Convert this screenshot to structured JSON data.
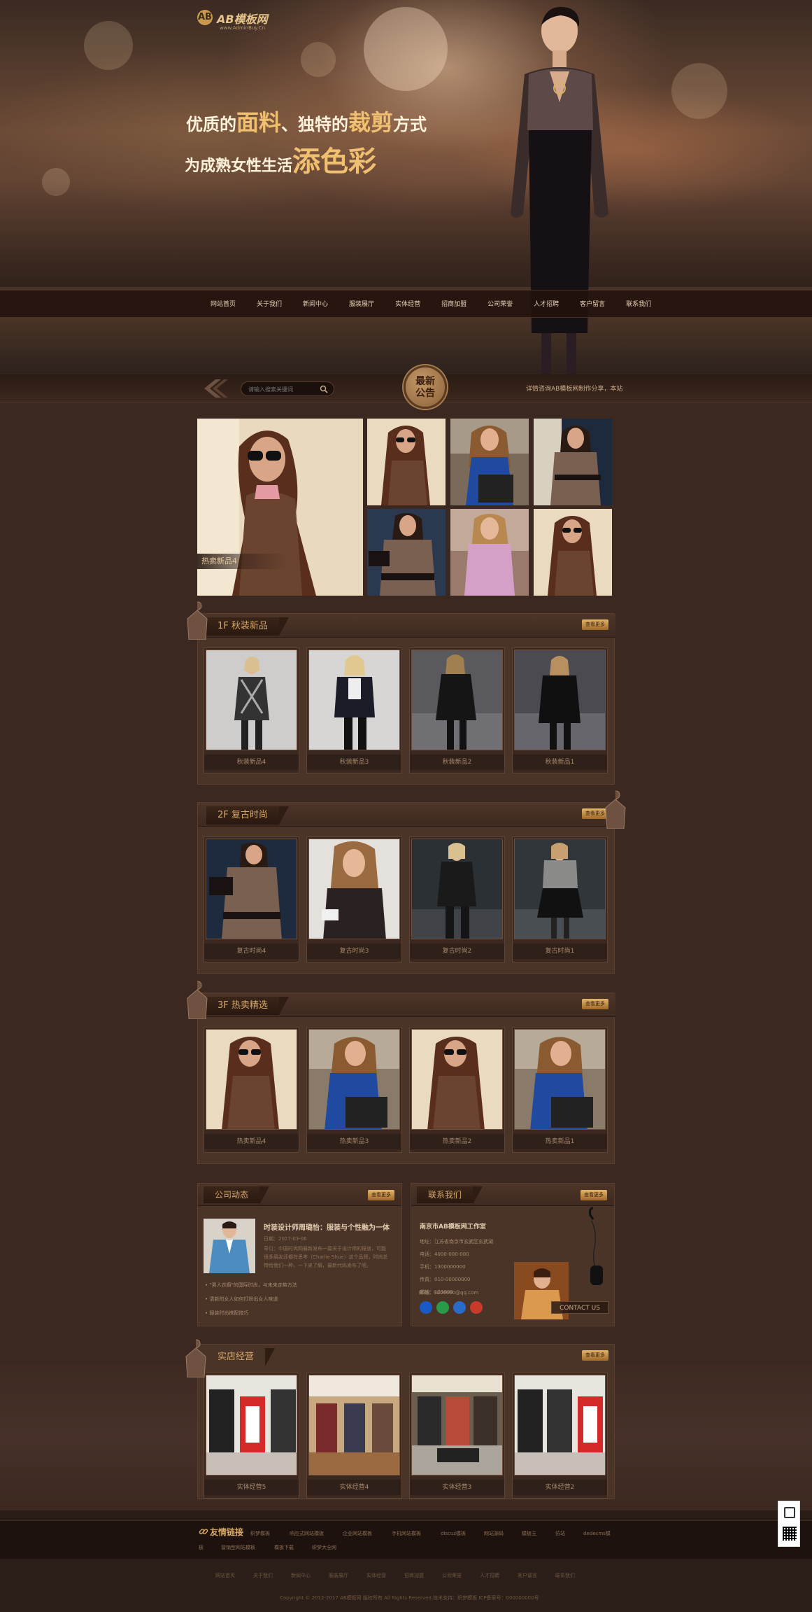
{
  "brand": {
    "logo_mark": "AB",
    "name": "AB模板网",
    "url": "www.AdminBuy.Cn"
  },
  "hero": {
    "slogan1_a": "优质的",
    "slogan1_b": "面料",
    "slogan1_c": "、独特的",
    "slogan1_d": "裁剪",
    "slogan1_e": "方式",
    "slogan2_a": "为成熟女性生活",
    "slogan2_b": "添色彩"
  },
  "nav": {
    "items": [
      "网站首页",
      "关于我们",
      "新闻中心",
      "服装展厅",
      "实体经营",
      "招商加盟",
      "公司荣誉",
      "人才招聘",
      "客户留言",
      "联系我们"
    ]
  },
  "search": {
    "placeholder": "请输入搜索关键词"
  },
  "notice": {
    "badge_l1": "最新",
    "badge_l2": "公告",
    "text": "详情咨询AB模板网制作分享，本站"
  },
  "hot_feature": {
    "caption": "热卖新品4"
  },
  "sections": [
    {
      "title": "1F 秋装新品",
      "more": "查看更多",
      "items": [
        "秋装新品4",
        "秋装新品3",
        "秋装新品2",
        "秋装新品1"
      ]
    },
    {
      "title": "2F 复古时尚",
      "more": "查看更多",
      "items": [
        "复古时尚4",
        "复古时尚3",
        "复古时尚2",
        "复古时尚1"
      ]
    },
    {
      "title": "3F 热卖精选",
      "more": "查看更多",
      "items": [
        "热卖新品4",
        "热卖新品3",
        "热卖新品2",
        "热卖新品1"
      ]
    }
  ],
  "news": {
    "title": "公司动态",
    "more": "查看更多",
    "headline": "时装设计师周璐怡：服装与个性融为一体",
    "date": "日期：2017-03-06",
    "summary1": "导引：中国时尚网最新发布一篇关于设计师的报道，可能",
    "summary2": "很多朋友还都在思考（Charlie Shue）这个品牌，时尚总",
    "summary3": "带给我们一种，一下来了解，最新代码发布了呢。",
    "items": [
      "• \"男人衣橱\"的国际时尚，与未来走势方法",
      "• 清新的女人如何打扮出女人味道",
      "• 服装时尚搭配技巧"
    ]
  },
  "contact": {
    "title": "联系我们",
    "more": "查看更多",
    "company": "南京市AB模板网工作室",
    "address": "地址：江苏省南京市玄武区玄武湖",
    "phone": "电话：4000-000-000",
    "mobile": "手机：1300000000",
    "fax": "传真：010-00000000",
    "postcode": "邮编：123000",
    "email": "邮箱：9000000@qq.com",
    "button": "CONTACT US"
  },
  "stores": {
    "title": "实店经营",
    "more": "查看更多",
    "items": [
      "实体经营5",
      "实体经营4",
      "实体经营3",
      "实体经营2"
    ]
  },
  "friend_links": {
    "title": "友情链接",
    "items": [
      "织梦模板",
      "响应式网站模板",
      "企业网站模板",
      "手机网站模板",
      "discuz模板",
      "网站源码",
      "模板王",
      "仿站",
      "dedecms模",
      "板",
      "营销型网站模板",
      "模板下载",
      "织梦大全网"
    ]
  },
  "footer": {
    "nav": [
      "网站首页",
      "关于我们",
      "新闻中心",
      "服装展厅",
      "实体经营",
      "招商加盟",
      "公司荣誉",
      "人才招聘",
      "客户留言",
      "联系我们"
    ],
    "copyright": "Copyright © 2012-2017 AB模板网 版权所有 All Rights Reserved  技术支持：织梦模板  ICP备案号：000000000号"
  },
  "colors": {
    "accent": "#d5a867",
    "background": "#3b2820",
    "panel": "#4a3327"
  }
}
